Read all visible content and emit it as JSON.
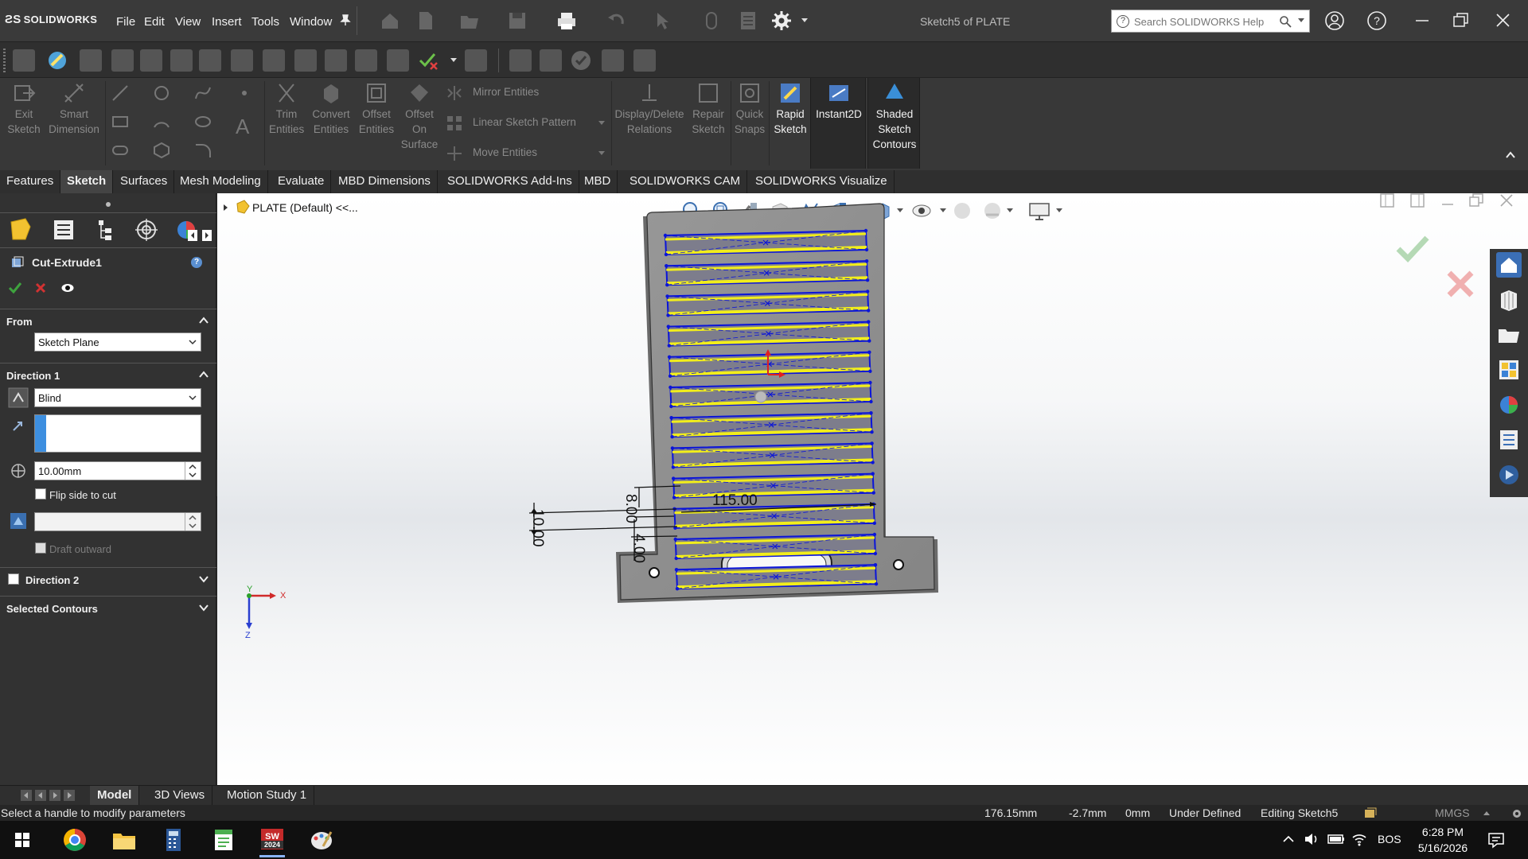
{
  "app": {
    "logo_text": "SOLIDWORKS",
    "document_title": "Sketch5 of PLATE",
    "menu": [
      "File",
      "Edit",
      "View",
      "Insert",
      "Tools",
      "Window"
    ],
    "search_placeholder": "Search SOLIDWORKS Help"
  },
  "command_manager": {
    "exit_sketch": [
      "Exit",
      "Sketch"
    ],
    "smart_dimension": [
      "Smart",
      "Dimension"
    ],
    "trim_entities": [
      "Trim",
      "Entities"
    ],
    "convert_entities": [
      "Convert",
      "Entities"
    ],
    "offset_entities": [
      "Offset",
      "Entities"
    ],
    "offset_on_surface": [
      "Offset",
      "On",
      "Surface"
    ],
    "mirror_entities": "Mirror Entities",
    "linear_sketch_pattern": "Linear Sketch Pattern",
    "move_entities": "Move Entities",
    "display_delete_relations": [
      "Display/Delete",
      "Relations"
    ],
    "repair_sketch": [
      "Repair",
      "Sketch"
    ],
    "quick_snaps": [
      "Quick",
      "Snaps"
    ],
    "rapid_sketch": [
      "Rapid",
      "Sketch"
    ],
    "instant2d": "Instant2D",
    "shaded_sketch_contours": [
      "Shaded",
      "Sketch",
      "Contours"
    ]
  },
  "tabs": [
    "Features",
    "Sketch",
    "Surfaces",
    "Mesh Modeling",
    "Evaluate",
    "MBD Dimensions",
    "SOLIDWORKS Add-Ins",
    "MBD",
    "SOLIDWORKS CAM",
    "SOLIDWORKS Visualize"
  ],
  "active_tab": "Sketch",
  "property_manager": {
    "title": "Cut-Extrude1",
    "help": "?",
    "from": {
      "header": "From",
      "value": "Sketch Plane"
    },
    "direction1": {
      "header": "Direction 1",
      "end_condition": "Blind",
      "depth": "10.00mm",
      "flip_side_label": "Flip side to cut",
      "draft_outward_label": "Draft outward"
    },
    "direction2": {
      "header": "Direction 2"
    },
    "selected_contours": {
      "header": "Selected Contours"
    }
  },
  "viewport": {
    "tree_root": "PLATE  (Default) <<...",
    "dimensions": {
      "width_label": "115.00",
      "gap_label": "8.00",
      "offset_label": "4.00",
      "height_label": "10.00"
    },
    "triad": {
      "x": "X",
      "y": "Y",
      "z": "Z"
    }
  },
  "bottom_tabs": [
    "Model",
    "3D Views",
    "Motion Study 1"
  ],
  "active_bottom_tab": "Model",
  "status_bar": {
    "message": "Select a handle to modify parameters",
    "x": "176.15mm",
    "y": "-2.7mm",
    "z": "0mm",
    "state": "Under Defined",
    "editing": "Editing Sketch5",
    "units": "MMGS"
  },
  "taskbar": {
    "language": "BOS",
    "time": "6:28 PM",
    "date": "5/16/2026",
    "solidworks_badge": "2024"
  },
  "colors": {
    "accent_blue": "#0a14d9",
    "sketch_yellow": "#f2ee1b",
    "part_gray": "#8c8c8c",
    "ok_green": "#3ea33e",
    "cancel_red": "#d23232"
  }
}
